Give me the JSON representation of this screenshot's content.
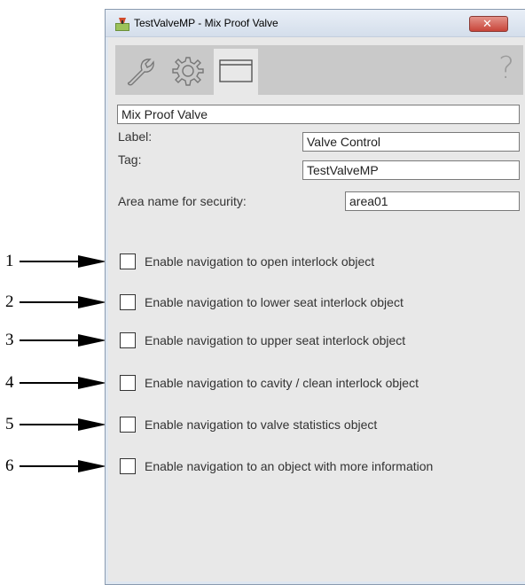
{
  "callouts": [
    "1",
    "2",
    "3",
    "4",
    "5",
    "6"
  ],
  "window": {
    "title": "TestValveMP - Mix Proof Valve",
    "close_label": "✕",
    "help_label": "?"
  },
  "tabs": [
    {
      "icon": "wrench-icon"
    },
    {
      "icon": "gear-icon"
    },
    {
      "icon": "window-icon"
    }
  ],
  "form": {
    "description_value": "Mix Proof Valve",
    "label_caption": "Label:",
    "label_value": "Valve Control",
    "tag_caption": "Tag:",
    "tag_value": "TestValveMP",
    "area_caption": "Area name for security:",
    "area_value": "area01"
  },
  "checkboxes": [
    {
      "label": "Enable navigation to open interlock object",
      "checked": false
    },
    {
      "label": "Enable navigation to lower seat interlock object",
      "checked": false
    },
    {
      "label": "Enable navigation to upper seat interlock object",
      "checked": false
    },
    {
      "label": "Enable navigation to cavity / clean interlock object",
      "checked": false
    },
    {
      "label": "Enable navigation to valve statistics object",
      "checked": false
    },
    {
      "label": "Enable navigation to an object with more information",
      "checked": false
    }
  ]
}
